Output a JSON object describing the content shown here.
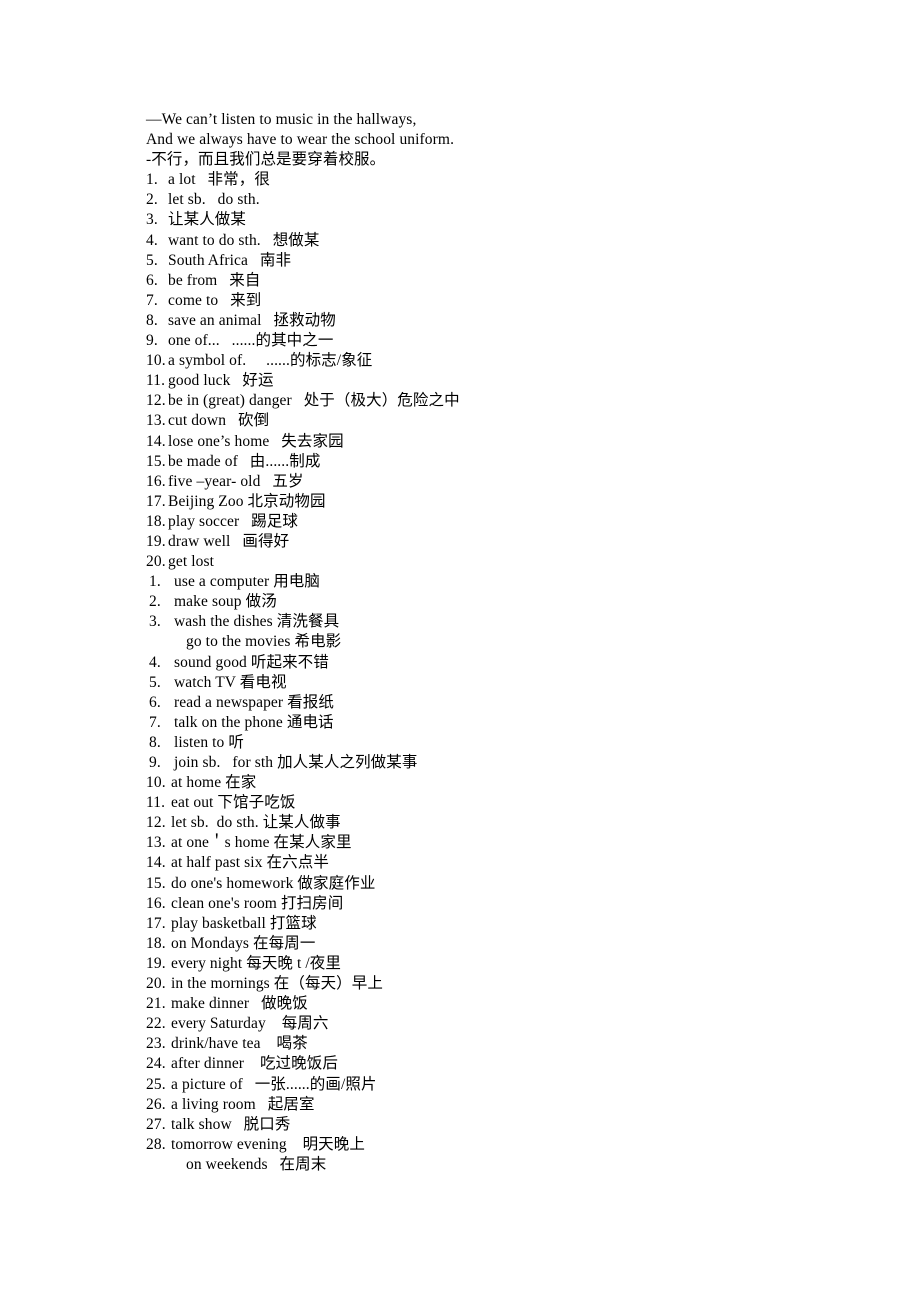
{
  "document": {
    "page_background": "#ffffff",
    "text_color": "#000000",
    "intro_lines": [
      "—We can’t listen to music in the hallways,",
      "And we always have to wear the school uniform.",
      "-不行，而且我们总是要穿着校服。"
    ],
    "list_a": [
      {
        "num": "1.",
        "text": "a lot   非常，很"
      },
      {
        "num": "2.",
        "text": "let sb.   do sth."
      },
      {
        "num": "3.",
        "text": "让某人做某"
      },
      {
        "num": "4.",
        "text": "want to do sth.   想做某"
      },
      {
        "num": "5.",
        "text": "South Africa   南非"
      },
      {
        "num": "6.",
        "text": "be from   来自"
      },
      {
        "num": "7.",
        "text": "come to   来到"
      },
      {
        "num": "8.",
        "text": "save an animal   拯救动物"
      },
      {
        "num": "9.",
        "text": "one of...   ......的其中之一"
      },
      {
        "num": "10.",
        "text": "a symbol of.     ......的标志/象征"
      },
      {
        "num": "11.",
        "text": "good luck   好运"
      },
      {
        "num": "12.",
        "text": "be in (great) danger   处于（极大）危险之中"
      },
      {
        "num": "13.",
        "text": "cut down   砍倒"
      },
      {
        "num": "14.",
        "text": "lose one’s home   失去家园"
      },
      {
        "num": "15.",
        "text": "be made of   由......制成"
      },
      {
        "num": "16.",
        "text": "five –year- old   五岁"
      },
      {
        "num": "17.",
        "text": "Beijing Zoo 北京动物园"
      },
      {
        "num": "18.",
        "text": "play soccer   踢足球"
      },
      {
        "num": "19.",
        "text": "draw well   画得好"
      },
      {
        "num": "20.",
        "text": "get lost"
      }
    ],
    "list_b": [
      {
        "num": "1.",
        "text": "use a computer 用电脑"
      },
      {
        "num": "2.",
        "text": "make soup 做汤"
      },
      {
        "num": "3.",
        "text": "wash the dishes 清洗餐具"
      },
      {
        "num": "",
        "text": "go to the movies 希电影",
        "continuation": true
      },
      {
        "num": "4.",
        "text": "sound good 听起来不错"
      },
      {
        "num": "5.",
        "text": "watch TV 看电视"
      },
      {
        "num": "6.",
        "text": "read a newspaper 看报纸"
      },
      {
        "num": "7.",
        "text": "talk on the phone 通电话"
      },
      {
        "num": "8.",
        "text": "listen to 听"
      },
      {
        "num": "9.",
        "text": "join sb.   for sth 加人某人之列做某事"
      },
      {
        "num": "10.",
        "text": "at home 在家"
      },
      {
        "num": "11.",
        "text": "eat out 下馆子吃饭"
      },
      {
        "num": "12.",
        "text": "let sb.  do sth. 让某人做事"
      },
      {
        "num": "13.",
        "text": "at one＇s home 在某人家里"
      },
      {
        "num": "14.",
        "text": "at half past six 在六点半"
      },
      {
        "num": "15.",
        "text": "do one's homework 做家庭作业"
      },
      {
        "num": "16.",
        "text": "clean one's room 打扫房间"
      },
      {
        "num": "17.",
        "text": "play basketball 打篮球"
      },
      {
        "num": "18.",
        "text": "on Mondays 在每周一"
      },
      {
        "num": "19.",
        "text": "every night 每天晚 t /夜里"
      },
      {
        "num": "20.",
        "text": "in the mornings 在（每天）早上"
      },
      {
        "num": "21.",
        "text": "make dinner   做晚饭"
      },
      {
        "num": "22.",
        "text": "every Saturday    每周六"
      },
      {
        "num": "23.",
        "text": "drink/have tea    喝茶"
      },
      {
        "num": "24.",
        "text": "after dinner    吃过晚饭后"
      },
      {
        "num": "25.",
        "text": "a picture of   一张......的画/照片"
      },
      {
        "num": "26.",
        "text": "a living room   起居室"
      },
      {
        "num": "27.",
        "text": "talk show   脱口秀"
      },
      {
        "num": "28.",
        "text": "tomorrow evening    明天晚上"
      },
      {
        "num": "",
        "text": "on weekends   在周末",
        "continuation": true
      }
    ]
  }
}
